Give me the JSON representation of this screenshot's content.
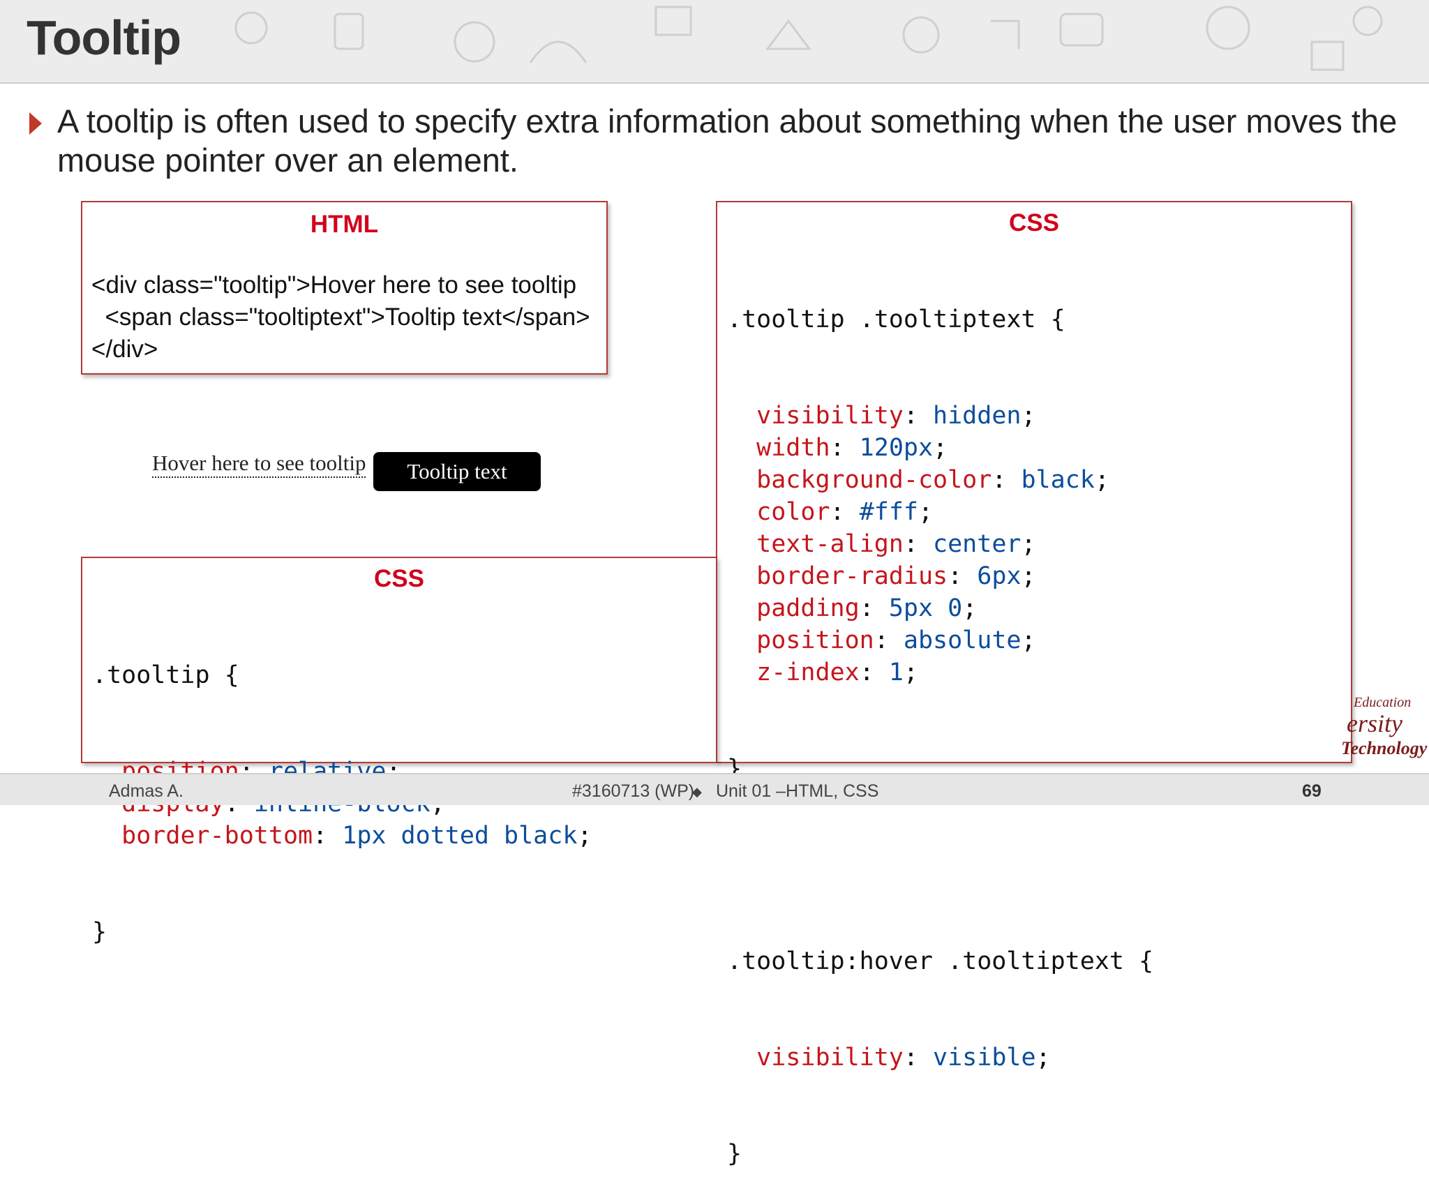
{
  "slide": {
    "title": "Tooltip",
    "bullet": "A tooltip is often used to specify extra information about something when the user moves the mouse pointer over an element."
  },
  "html_box": {
    "heading": "HTML",
    "lines": [
      "<div class=\"tooltip\">Hover here to see tooltip",
      "  <span class=\"tooltiptext\">Tooltip text</span>",
      "</div>"
    ]
  },
  "demo": {
    "text": "Hover here to see tooltip",
    "tooltip": "Tooltip text"
  },
  "css_left": {
    "heading": "CSS",
    "selector": ".tooltip {",
    "rules": [
      {
        "prop": "position",
        "value": "relative"
      },
      {
        "prop": "display",
        "value": "inline-block"
      },
      {
        "prop": "border-bottom",
        "value": "1px dotted black"
      }
    ],
    "close": "}"
  },
  "css_right": {
    "heading": "CSS",
    "selector1": ".tooltip .tooltiptext {",
    "rules1": [
      {
        "prop": "visibility",
        "value": "hidden"
      },
      {
        "prop": "width",
        "value": "120px"
      },
      {
        "prop": "background-color",
        "value": "black"
      },
      {
        "prop": "color",
        "value": "#fff"
      },
      {
        "prop": "text-align",
        "value": "center"
      },
      {
        "prop": "border-radius",
        "value": "6px"
      },
      {
        "prop": "padding",
        "value": "5px 0"
      },
      {
        "prop": "position",
        "value": "absolute"
      },
      {
        "prop": "z-index",
        "value": "1"
      }
    ],
    "close1": "}",
    "selector2": ".tooltip:hover .tooltiptext {",
    "rules2": [
      {
        "prop": "visibility",
        "value": "visible"
      }
    ],
    "close2": "}"
  },
  "logo": {
    "line1": "Education",
    "line2": "ersity",
    "line3": "Technology"
  },
  "footer": {
    "author": "Admas A.",
    "course": "#3160713 (WP)",
    "separator": "◆",
    "unit": "Unit 01 –HTML, CSS",
    "page": "69"
  },
  "colors": {
    "accent": "#c0392b",
    "heading_red": "#d0021b",
    "property": "#c4161c",
    "value": "#0b4d9b"
  }
}
